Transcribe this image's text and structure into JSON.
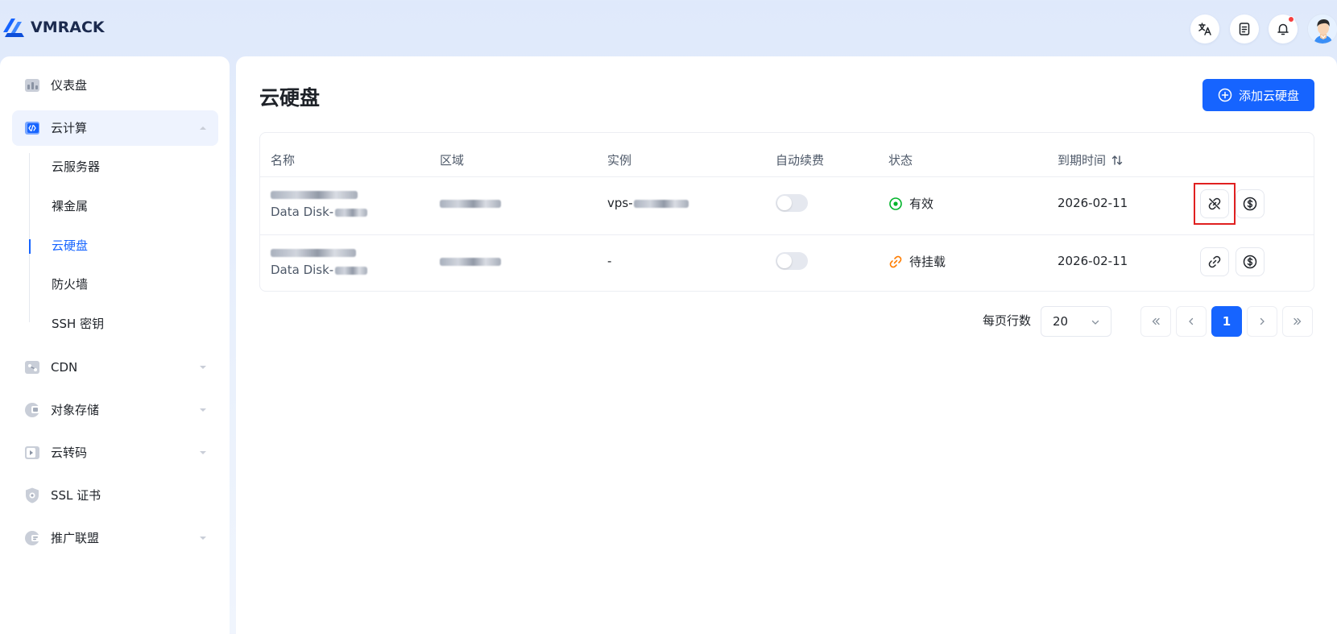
{
  "brand": {
    "name": "VMRACK"
  },
  "sidebar": {
    "items": [
      {
        "label": "仪表盘",
        "icon": "dashboard-icon"
      },
      {
        "label": "云计算",
        "icon": "cloud-compute-icon",
        "expanded": true,
        "children": [
          {
            "label": "云服务器"
          },
          {
            "label": "裸金属"
          },
          {
            "label": "云硬盘",
            "active": true
          },
          {
            "label": "防火墙"
          },
          {
            "label": "SSH 密钥"
          }
        ]
      },
      {
        "label": "CDN",
        "icon": "cdn-icon"
      },
      {
        "label": "对象存储",
        "icon": "object-storage-icon"
      },
      {
        "label": "云转码",
        "icon": "transcode-icon"
      },
      {
        "label": "SSL 证书",
        "icon": "ssl-certificate-icon"
      },
      {
        "label": "推广联盟",
        "icon": "affiliate-icon"
      }
    ]
  },
  "main": {
    "title": "云硬盘",
    "add_button": "添加云硬盘",
    "table": {
      "columns": [
        "名称",
        "区域",
        "实例",
        "自动续费",
        "状态",
        "到期时间"
      ],
      "rows": [
        {
          "name_sub": "Data Disk-",
          "instance": "vps-",
          "auto_renew": false,
          "status": "有效",
          "status_color": "#00b42a",
          "expiry": "2026-02-11"
        },
        {
          "name_sub": "Data Disk-",
          "instance": "-",
          "auto_renew": false,
          "status": "待挂载",
          "status_color": "#ff7d00",
          "expiry": "2026-02-11"
        }
      ]
    },
    "pagination": {
      "rows_per_page_label": "每页行数",
      "rows_per_page": "20",
      "current_page": "1"
    }
  },
  "colors": {
    "primary": "#1664ff",
    "highlight": "#e02020"
  }
}
